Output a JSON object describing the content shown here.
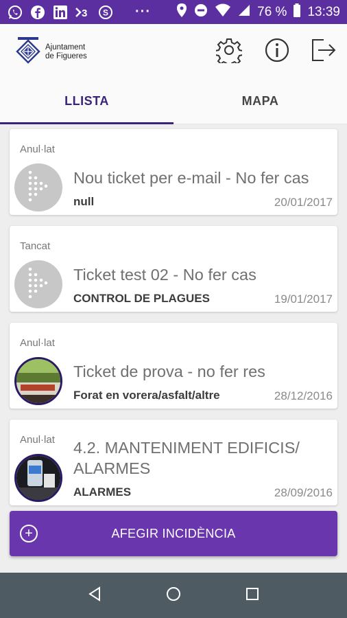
{
  "status_bar": {
    "icons": [
      "whatsapp-icon",
      "facebook-icon",
      "linkedin-icon",
      "rss-icon",
      "counter-icon"
    ],
    "overflow": "···",
    "battery": "76 %",
    "time": "13:39",
    "background": "#5b2fa0"
  },
  "header": {
    "logo_line1": "Ajuntament",
    "logo_line2": "de Figueres",
    "actions": [
      "settings-icon",
      "info-icon",
      "logout-icon"
    ]
  },
  "tabs": [
    {
      "label": "LLISTA",
      "active": true
    },
    {
      "label": "MAPA",
      "active": false
    }
  ],
  "tickets": [
    {
      "status": "Anul·lat",
      "title": "Nou ticket per e-mail - No fer cas",
      "category": "null",
      "date": "20/01/2017",
      "thumb": "default"
    },
    {
      "status": "Tancat",
      "title": "Ticket test 02 - No fer cas",
      "category": "CONTROL DE PLAGUES",
      "date": "19/01/2017",
      "thumb": "default"
    },
    {
      "status": "Anul·lat",
      "title": "Ticket de prova - no fer res",
      "category": "Forat en vorera/asfalt/altre",
      "date": "28/12/2016",
      "thumb": "photo"
    },
    {
      "status": "Anul·lat",
      "title": "4.2. MANTENIMENT EDIFICIS/ ALARMES",
      "category": "ALARMES",
      "date": "28/09/2016",
      "thumb": "photo"
    }
  ],
  "add_button": {
    "label": "AFEGIR INCIDÈNCIA",
    "icon": "plus-circle-icon",
    "color": "#6a36ad"
  },
  "accent_color": "#3a237c"
}
